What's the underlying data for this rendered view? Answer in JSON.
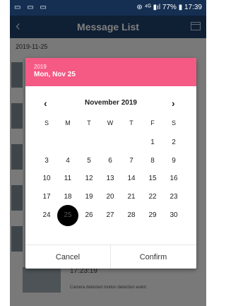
{
  "status_bar": {
    "right_text": "⊛ ⁴ᴳ ▮ıl 77% ▮ 17:39"
  },
  "app_bar": {
    "title": "Message List"
  },
  "list": {
    "date_header": "2019-11-25",
    "last_item": {
      "time": "17:23:19",
      "description": "Camera detected motion detection event"
    }
  },
  "date_picker": {
    "header_year": "2019",
    "header_date": "Mon, Nov 25",
    "month_label": "November 2019",
    "prev_icon": "‹",
    "next_icon": "›",
    "weekdays": [
      "S",
      "M",
      "T",
      "W",
      "T",
      "F",
      "S"
    ],
    "weeks": [
      [
        "",
        "",
        "",
        "",
        "",
        "1",
        "2"
      ],
      [
        "3",
        "4",
        "5",
        "6",
        "7",
        "8",
        "9"
      ],
      [
        "10",
        "11",
        "12",
        "13",
        "14",
        "15",
        "16"
      ],
      [
        "17",
        "18",
        "19",
        "20",
        "21",
        "22",
        "23"
      ],
      [
        "24",
        "25",
        "26",
        "27",
        "28",
        "29",
        "30"
      ]
    ],
    "selected_day": "25",
    "cancel_label": "Cancel",
    "confirm_label": "Confirm"
  },
  "colors": {
    "accent": "#f55a84",
    "app_bar": "#1e3f68",
    "selected_day": "#000000"
  }
}
